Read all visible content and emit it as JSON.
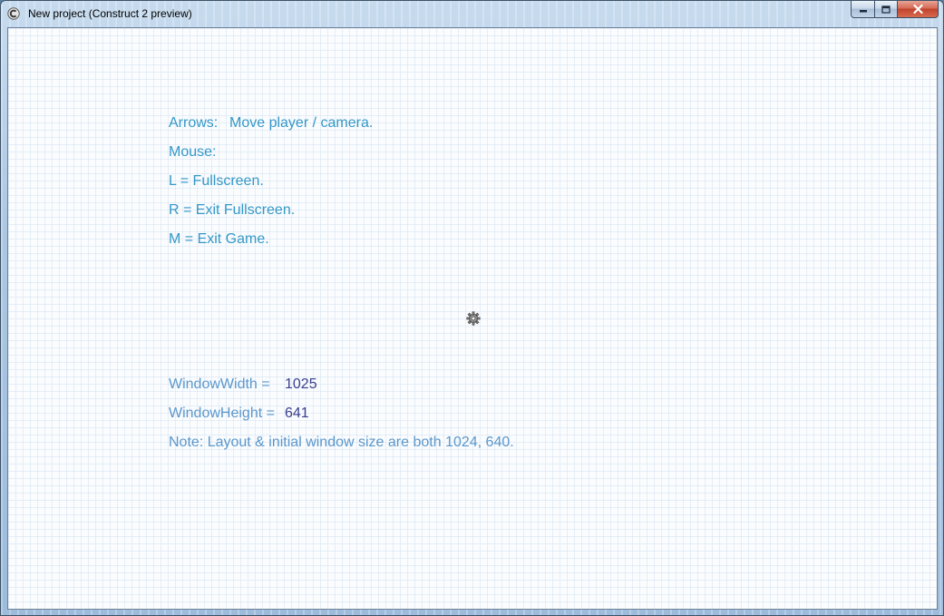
{
  "window": {
    "title": "New project (Construct 2 preview)"
  },
  "caption_buttons": {
    "minimize_icon": "minimize-icon",
    "maximize_icon": "maximize-icon",
    "close_icon": "close-icon"
  },
  "instructions": {
    "arrows_label": "Arrows:",
    "arrows_text": "Move player / camera.",
    "mouse_label": "Mouse:",
    "fullscreen": "L = Fullscreen.",
    "exit_fullscreen": "R = Exit Fullscreen.",
    "exit_game": "M = Exit Game."
  },
  "stats": {
    "width_label": "WindowWidth =",
    "width_value": "1025",
    "height_label": "WindowHeight =",
    "height_value": "641",
    "note": "Note: Layout & initial window size are both 1024, 640."
  },
  "colors": {
    "instruction_text": "#3498c8",
    "stat_label_text": "#5b97cc",
    "stat_value_text": "#3a3f8c"
  },
  "icons": {
    "app_icon": "construct-app-icon",
    "cursor": "gear-cursor-icon"
  }
}
